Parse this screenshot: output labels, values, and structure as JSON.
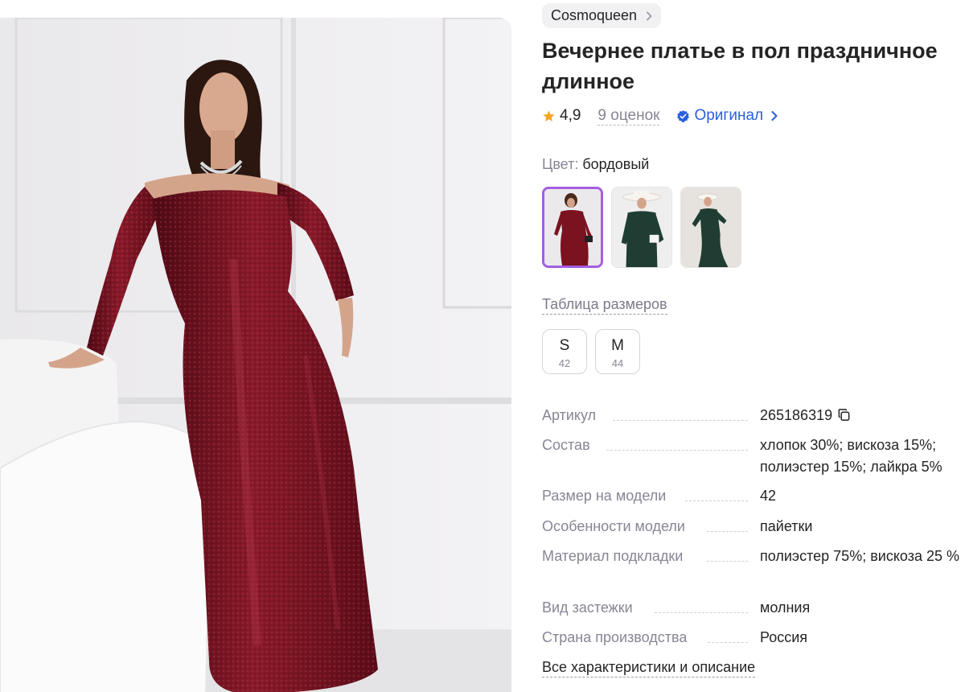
{
  "product": {
    "brand": "Cosmoqueen",
    "title": "Вечернее платье в пол праздничное длинное",
    "rating": "4,9",
    "reviews": "9 оценок",
    "original_label": "Оригинал",
    "color_label": "Цвет:",
    "color_value": "бордовый",
    "size_table_label": "Таблица размеров",
    "sizes": [
      {
        "letter": "S",
        "number": "42"
      },
      {
        "letter": "M",
        "number": "44"
      }
    ],
    "variants": [
      {
        "name": "бордовый",
        "selected": true
      },
      {
        "name": "изумрудный",
        "selected": false
      },
      {
        "name": "изумрудный",
        "selected": false
      }
    ]
  },
  "specs": [
    {
      "key": "Артикул",
      "value": "265186319",
      "copy": true
    },
    {
      "key": "Состав",
      "value": "хлопок 30%; вискоза 15%; полиэстер 15%; лайкра 5%"
    },
    {
      "key": "Размер на модели",
      "value": "42"
    },
    {
      "key": "Особенности модели",
      "value": "пайетки"
    },
    {
      "key": "Материал подкладки",
      "value": "полиэстер 75%; вискоза 25 %"
    },
    {
      "key": "Вид застежки",
      "value": "молния"
    },
    {
      "key": "Страна производства",
      "value": "Россия"
    }
  ],
  "all_specs_link": "Все характеристики и описание",
  "colors": {
    "accent_purple": "#a35ee0",
    "link_blue": "#2a5fe0",
    "star_orange": "#f5a623",
    "muted_text": "#868695",
    "dress_burgundy": "#7a1220",
    "dress_green": "#1f3d33"
  }
}
